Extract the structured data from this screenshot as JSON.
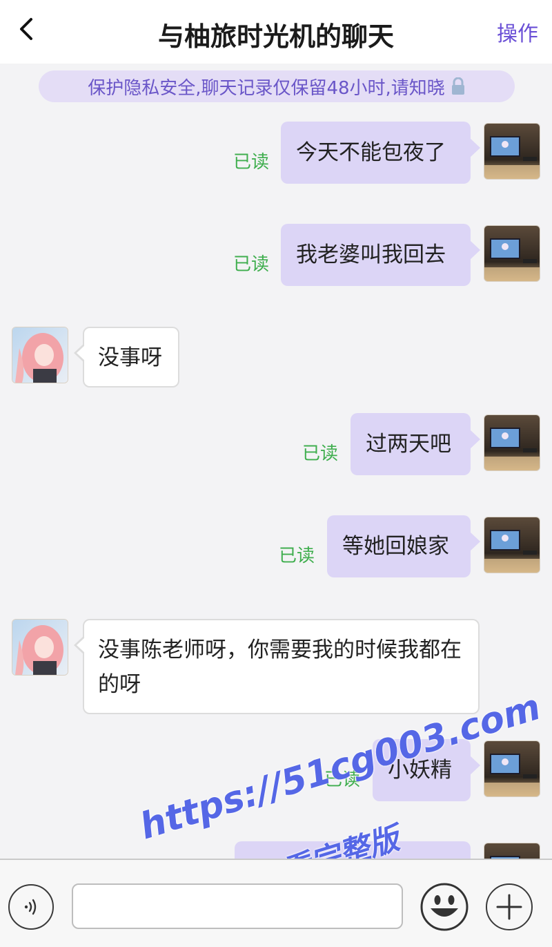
{
  "header": {
    "back_icon": "chevron-left-icon",
    "title": "与柚旅时光机的聊天",
    "action": "操作"
  },
  "notice": {
    "text": "保护隐私安全,聊天记录仅保留48小时,请知晓",
    "icon": "lock-icon"
  },
  "read_label": "已读",
  "messages": [
    {
      "side": "out",
      "text": "今天不能包夜了",
      "status": "已读"
    },
    {
      "side": "out",
      "text": "我老婆叫我回去",
      "status": "已读"
    },
    {
      "side": "in",
      "text": "没事呀"
    },
    {
      "side": "out",
      "text": "过两天吧",
      "status": "已读"
    },
    {
      "side": "out",
      "text": "等她回娘家",
      "status": "已读"
    },
    {
      "side": "in",
      "text": "没事陈老师呀，你需要我的时候我都在的呀"
    },
    {
      "side": "out",
      "text": "小妖精",
      "status": "已读"
    },
    {
      "side": "out",
      "text": ""
    }
  ],
  "watermark": {
    "line1": "https://51cg003.com",
    "line2": "看完整版"
  },
  "bottom_bar": {
    "voice_icon": "voice-icon",
    "input_value": "",
    "emoji_icon": "emoji-icon",
    "plus_icon": "plus-icon"
  },
  "colors": {
    "outgoing_bubble": "#dcd5f6",
    "incoming_bubble": "#ffffff",
    "read_status": "#3fae4e",
    "accent": "#6a4fd6",
    "watermark": "#5567e6"
  }
}
